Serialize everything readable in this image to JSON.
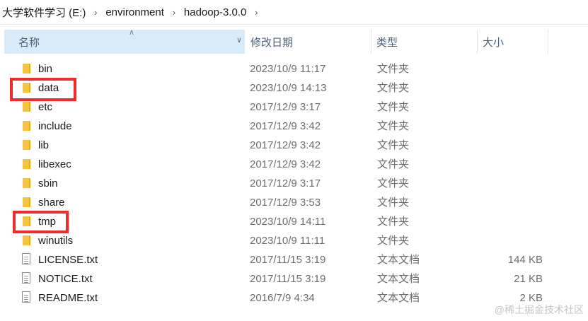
{
  "breadcrumb": [
    "大学软件学习 (E:)",
    "environment",
    "hadoop-3.0.0"
  ],
  "columns": {
    "name": "名称",
    "date": "修改日期",
    "type": "类型",
    "size": "大小"
  },
  "rows": [
    {
      "name": "bin",
      "date": "2023/10/9 11:17",
      "type": "文件夹",
      "size": "",
      "icon": "folder-icon"
    },
    {
      "name": "data",
      "date": "2023/10/9 14:13",
      "type": "文件夹",
      "size": "",
      "icon": "folder-icon"
    },
    {
      "name": "etc",
      "date": "2017/12/9 3:17",
      "type": "文件夹",
      "size": "",
      "icon": "folder-icon"
    },
    {
      "name": "include",
      "date": "2017/12/9 3:42",
      "type": "文件夹",
      "size": "",
      "icon": "folder-icon"
    },
    {
      "name": "lib",
      "date": "2017/12/9 3:42",
      "type": "文件夹",
      "size": "",
      "icon": "folder-icon"
    },
    {
      "name": "libexec",
      "date": "2017/12/9 3:42",
      "type": "文件夹",
      "size": "",
      "icon": "folder-icon"
    },
    {
      "name": "sbin",
      "date": "2017/12/9 3:17",
      "type": "文件夹",
      "size": "",
      "icon": "folder-icon"
    },
    {
      "name": "share",
      "date": "2017/12/9 3:53",
      "type": "文件夹",
      "size": "",
      "icon": "folder-icon"
    },
    {
      "name": "tmp",
      "date": "2023/10/9 14:11",
      "type": "文件夹",
      "size": "",
      "icon": "folder-icon"
    },
    {
      "name": "winutils",
      "date": "2023/10/9 11:11",
      "type": "文件夹",
      "size": "",
      "icon": "folder-icon"
    },
    {
      "name": "LICENSE.txt",
      "date": "2017/11/15 3:19",
      "type": "文本文档",
      "size": "144 KB",
      "icon": "text-file-icon"
    },
    {
      "name": "NOTICE.txt",
      "date": "2017/11/15 3:19",
      "type": "文本文档",
      "size": "21 KB",
      "icon": "text-file-icon"
    },
    {
      "name": "README.txt",
      "date": "2016/7/9 4:34",
      "type": "文本文档",
      "size": "2 KB",
      "icon": "text-file-icon"
    }
  ],
  "highlight_color": "#ef2b2b",
  "folder_color": "#f5c542",
  "header_selected_color": "#d9ebf9",
  "watermark": "@稀土掘金技术社区"
}
